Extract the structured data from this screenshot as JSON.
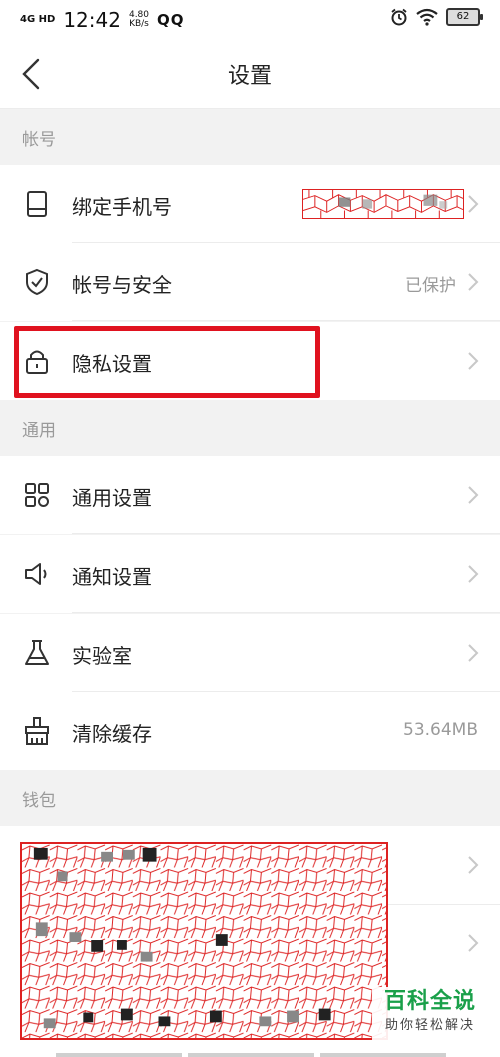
{
  "status_bar": {
    "network": "4G HD",
    "time": "12:42",
    "speed_value": "4.80",
    "speed_unit": "KB/s",
    "qq": "QQ",
    "battery": "62",
    "icons": [
      "alarm-icon",
      "wifi-icon",
      "battery-icon"
    ]
  },
  "nav": {
    "title": "设置",
    "back_icon": "chevron-left-icon"
  },
  "sections": {
    "account": {
      "header": "帐号",
      "items": [
        {
          "label": "绑定手机号",
          "icon": "phone-icon",
          "value": ""
        },
        {
          "label": "帐号与安全",
          "icon": "shield-check-icon",
          "value": "已保护"
        },
        {
          "label": "隐私设置",
          "icon": "lock-icon",
          "value": ""
        }
      ]
    },
    "general": {
      "header": "通用",
      "items": [
        {
          "label": "通用设置",
          "icon": "grid-icon",
          "value": ""
        },
        {
          "label": "通知设置",
          "icon": "speaker-icon",
          "value": ""
        },
        {
          "label": "实验室",
          "icon": "flask-icon",
          "value": ""
        },
        {
          "label": "清除缓存",
          "icon": "broom-icon",
          "value": "53.64MB"
        }
      ]
    },
    "wallet": {
      "header": "钱包"
    }
  },
  "watermark": {
    "brand": "百科全说",
    "sub": "助你轻松解决"
  },
  "colors": {
    "highlight": "#e0121f",
    "watermark_green": "#1aa04a",
    "muted_text": "#9a9a9a"
  }
}
